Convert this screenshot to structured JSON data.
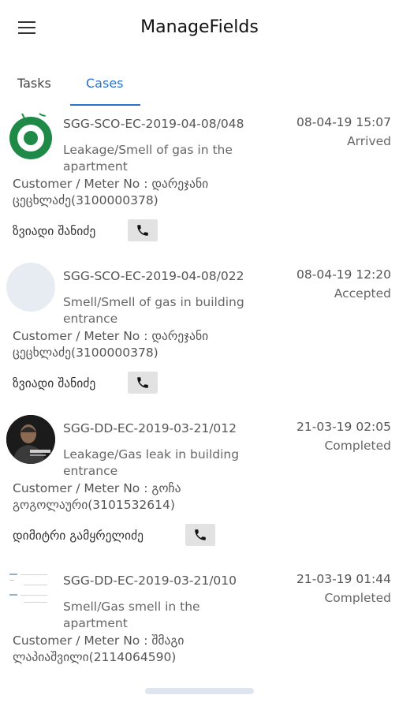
{
  "appbar": {
    "title": "ManageFields",
    "menu_icon": "hamburger-menu-icon"
  },
  "tabs": [
    {
      "label": "Tasks",
      "active": false
    },
    {
      "label": "Cases",
      "active": true
    }
  ],
  "colors": {
    "accent": "#2a73c9",
    "phone_button_bg": "#e2e2e2"
  },
  "cases": [
    {
      "id": "SGG-SCO-EC-2019-04-08/048",
      "date": "08-04-19 15:07",
      "status": "Arrived",
      "description": "Leakage/Smell of gas in the apartment",
      "customer": "Customer / Meter No : დარეჯანი ცეცხლაძე(3100000378)",
      "person": "ზვიადი შანიძე",
      "avatar": "green-logo-avatar"
    },
    {
      "id": "SGG-SCO-EC-2019-04-08/022",
      "date": "08-04-19 12:20",
      "status": "Accepted",
      "description": "Smell/Smell of gas in building entrance",
      "customer": "Customer / Meter No : დარეჯანი ცეცხლაძე(3100000378)",
      "person": "ზვიადი შანიძე",
      "avatar": "blank-avatar"
    },
    {
      "id": "SGG-DD-EC-2019-03-21/012",
      "date": "21-03-19 02:05",
      "status": "Completed",
      "description": "Leakage/Gas leak in building entrance",
      "customer": "Customer / Meter No : გოჩა გოგოლაური(3101532614)",
      "person": "დიმიტრი გამყრელიძე",
      "avatar": "photo-avatar"
    },
    {
      "id": "SGG-DD-EC-2019-03-21/010",
      "date": "21-03-19 01:44",
      "status": "Completed",
      "description": "Smell/Gas smell in the apartment",
      "customer": "Customer / Meter No : შმაგი ლაპიაშვილი(2114064590)",
      "avatar": "document-avatar"
    }
  ]
}
